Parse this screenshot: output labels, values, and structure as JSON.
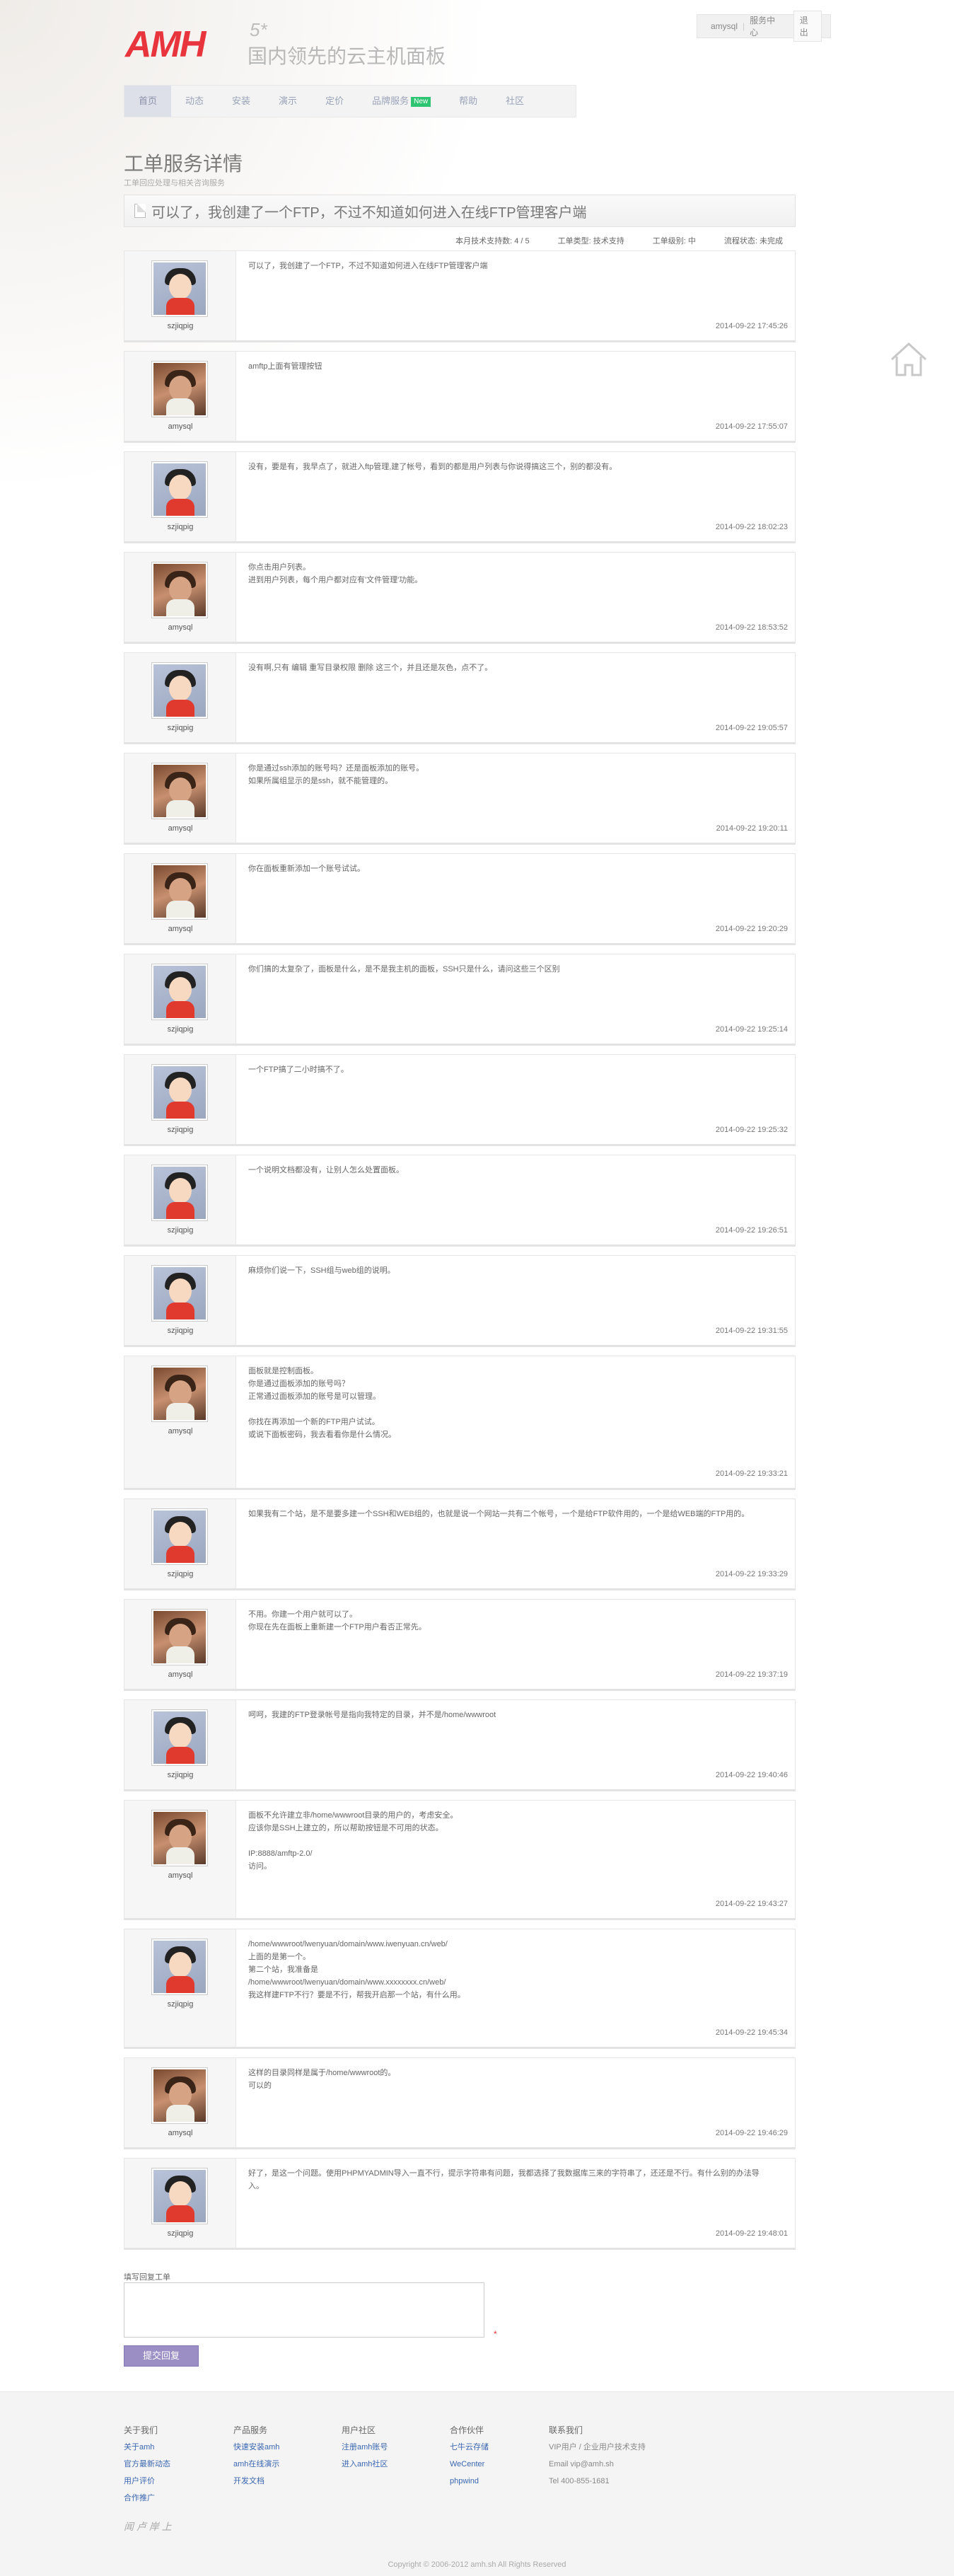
{
  "brand": {
    "logo": "AMH",
    "version": "5*",
    "slogan": "国内领先的云主机面板"
  },
  "usernav": {
    "user": "amysql",
    "center": "服务中心",
    "logout": "退出"
  },
  "nav": [
    {
      "label": "首页"
    },
    {
      "label": "动态"
    },
    {
      "label": "安装"
    },
    {
      "label": "演示"
    },
    {
      "label": "定价"
    },
    {
      "label": "品牌服务",
      "badge": "New"
    },
    {
      "label": "帮助"
    },
    {
      "label": "社区"
    }
  ],
  "page": {
    "title": "工单服务详情",
    "subtitle": "工单回应处理与相关咨询服务"
  },
  "ticket": {
    "title": "可以了，我创建了一个FTP，不过不知道如何进入在线FTP管理客户端",
    "info": [
      "本月技术支持数: 4 / 5",
      "工单类型: 技术支持",
      "工单级别: 中",
      "流程状态: 未完成"
    ]
  },
  "messages": [
    {
      "user": "szjiqpig",
      "text": "可以了，我创建了一个FTP，不过不知道如何进入在线FTP管理客户端",
      "time": "2014-09-22 17:45:26"
    },
    {
      "user": "amysql",
      "text": "amftp上面有管理按钮",
      "time": "2014-09-22 17:55:07"
    },
    {
      "user": "szjiqpig",
      "text": "没有，要是有，我早点了，就进入ftp管理,建了帐号，看到的都是用户列表与你说得搞这三个，别的都没有。",
      "time": "2014-09-22 18:02:23"
    },
    {
      "user": "amysql",
      "text": "你点击用户列表。\n进到用户列表，每个用户都对应有'文件管理'功能。",
      "time": "2014-09-22 18:53:52"
    },
    {
      "user": "szjiqpig",
      "text": "没有啊,只有 编辑 重写目录权限 删除 这三个，并且还是灰色，点不了。",
      "time": "2014-09-22 19:05:57"
    },
    {
      "user": "amysql",
      "text": "你是通过ssh添加的账号吗？还是面板添加的账号。\n如果所属组显示的是ssh，就不能管理的。",
      "time": "2014-09-22 19:20:11"
    },
    {
      "user": "amysql",
      "text": "你在面板重新添加一个账号试试。",
      "time": "2014-09-22 19:20:29"
    },
    {
      "user": "szjiqpig",
      "text": "你们搞的太复杂了，面板是什么，是不是我主机的面板，SSH只是什么，请问这些三个区别",
      "time": "2014-09-22 19:25:14"
    },
    {
      "user": "szjiqpig",
      "text": "一个FTP搞了二小时搞不了。",
      "time": "2014-09-22 19:25:32"
    },
    {
      "user": "szjiqpig",
      "text": "一个说明文档都没有，让别人怎么处置面板。",
      "time": "2014-09-22 19:26:51"
    },
    {
      "user": "szjiqpig",
      "text": "麻烦你们说一下，SSH组与web组的说明。",
      "time": "2014-09-22 19:31:55"
    },
    {
      "user": "amysql",
      "text": "面板就是控制面板。\n你是通过面板添加的账号吗？\n正常通过面板添加的账号是可以管理。\n\n你找在再添加一个新的FTP用户试试。\n或说下面板密码，我去看看你是什么情况。",
      "time": "2014-09-22 19:33:21"
    },
    {
      "user": "szjiqpig",
      "text": "如果我有二个站，是不是要多建一个SSH和WEB组的，也就是说一个网站一共有二个帐号，一个是给FTP软件用的，一个是给WEB端的FTP用的。",
      "time": "2014-09-22 19:33:29"
    },
    {
      "user": "amysql",
      "text": "不用。你建一个用户就可以了。\n你现在先在面板上重新建一个FTP用户看否正常先。",
      "time": "2014-09-22 19:37:19"
    },
    {
      "user": "szjiqpig",
      "text": "呵呵，我建的FTP登录帐号是指向我特定的目录，并不是/home/wwwroot",
      "time": "2014-09-22 19:40:46"
    },
    {
      "user": "amysql",
      "text": "面板不允许建立非/home/wwwroot目录的用户的，考虑安全。\n应该你是SSH上建立的，所以帮助按钮是不可用的状态。\n\nIP:8888/amftp-2.0/\n访问。",
      "time": "2014-09-22 19:43:27"
    },
    {
      "user": "szjiqpig",
      "text": "/home/wwwroot/lwenyuan/domain/www.iwenyuan.cn/web/\n上面的是第一个。\n第二个站，我准备是\n/home/wwwroot/lwenyuan/domain/www.xxxxxxxx.cn/web/\n我这样建FTP不行？要是不行，帮我开启那一个站，有什么用。",
      "time": "2014-09-22 19:45:34"
    },
    {
      "user": "amysql",
      "text": "这样的目录同样是属于/home/wwwroot的。\n可以的",
      "time": "2014-09-22 19:46:29"
    },
    {
      "user": "szjiqpig",
      "text": "好了，是这一个问题。使用PHPMYADMIN导入一直不行，提示字符串有问题，我都选择了我数据库三来的字符串了，还还是不行。有什么别的办法导入。",
      "time": "2014-09-22 19:48:01"
    }
  ],
  "reply": {
    "label": "填写回复工单",
    "required": "*",
    "submit": "提交回复"
  },
  "footer": {
    "cols": [
      {
        "h": "关于我们",
        "links": [
          "关于amh",
          "官方最新动态",
          "用户评价",
          "合作推广"
        ]
      },
      {
        "h": "产品服务",
        "links": [
          "快速安装amh",
          "amh在线演示",
          "开发文档"
        ]
      },
      {
        "h": "用户社区",
        "links": [
          "注册amh账号",
          "进入amh社区"
        ]
      },
      {
        "h": "合作伙伴",
        "links": [
          "七牛云存储",
          "WeCenter",
          "phpwind"
        ]
      },
      {
        "h": "联系我们",
        "plain": [
          "VIP用户 / 企业用户技术支持",
          "Email vip@amh.sh",
          "Tel 400-855-1681"
        ]
      }
    ],
    "signature": "闻 卢 岸 上",
    "copyright": "Copyright © 2006-2012 amh.sh All Rights Reserved"
  }
}
